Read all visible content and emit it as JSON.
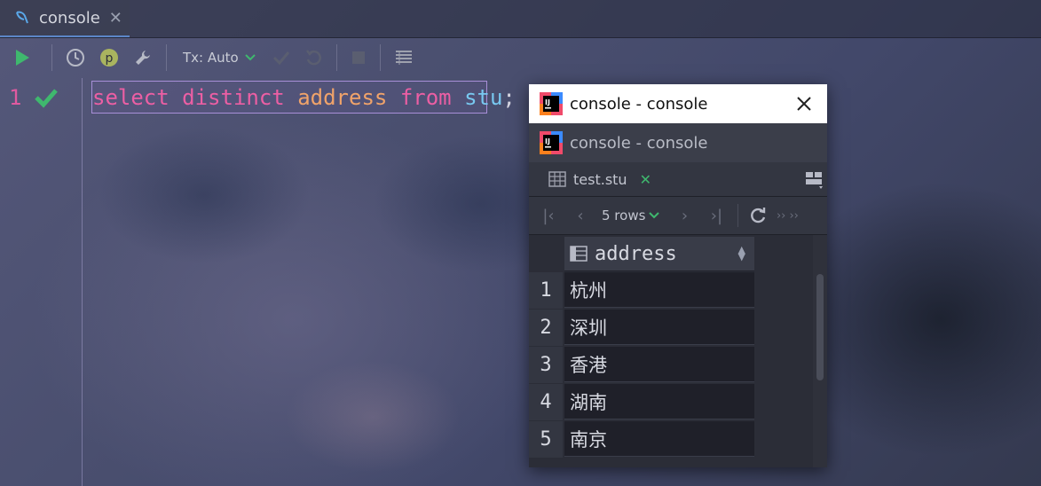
{
  "tab": {
    "label": "console",
    "close": "✕"
  },
  "toolbar": {
    "tx_label": "Tx: Auto"
  },
  "editor": {
    "line_number": "1",
    "code": {
      "k1": "select",
      "k2": "distinct",
      "col": "address",
      "k3": "from",
      "tbl": "stu",
      "end": ";"
    }
  },
  "popup": {
    "title_active": "console - console",
    "title_inactive": "console - console",
    "result_tab": "test.stu",
    "rows_label": "5 rows",
    "column_header": "address",
    "rows": [
      {
        "num": "1",
        "value": "杭州"
      },
      {
        "num": "2",
        "value": "深圳"
      },
      {
        "num": "3",
        "value": "香港"
      },
      {
        "num": "4",
        "value": "湖南"
      },
      {
        "num": "5",
        "value": "南京"
      }
    ]
  },
  "colors": {
    "keyword": "#ec5fa4",
    "column": "#f0a36a",
    "table": "#78c8f0",
    "accent_green": "#3fb86e"
  }
}
